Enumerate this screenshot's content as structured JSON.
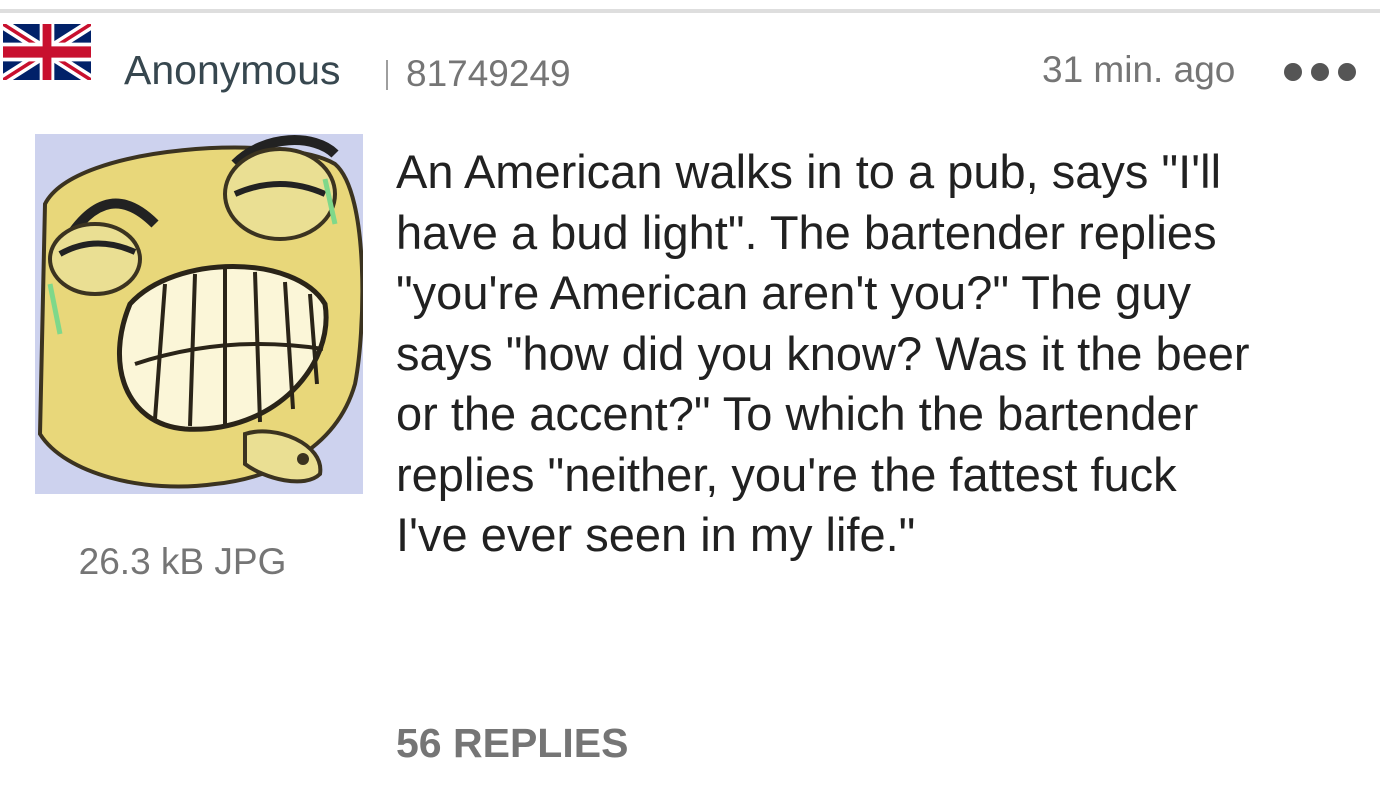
{
  "post": {
    "author": "Anonymous",
    "post_number": "81749249",
    "time_ago": "31 min. ago",
    "flag_icon": "uk-flag-icon",
    "more_icon": "more-horizontal-icon",
    "thumbnail": {
      "file_info": "26.3 kB JPG"
    },
    "body": "An American walks in to a pub, says \"I'll\nhave a bud light\". The bartender replies\n\"you're American aren't you?\" The guy\nsays \"how did you know? Was it the beer\nor the accent?\" To which the bartender\nreplies \"neither, you're the fattest fuck\nI've ever seen in my life.\"",
    "replies_label": "56 REPLIES"
  },
  "colors": {
    "author": "#37474f",
    "meta": "#757575",
    "text": "#212121",
    "divider": "#dedede"
  }
}
